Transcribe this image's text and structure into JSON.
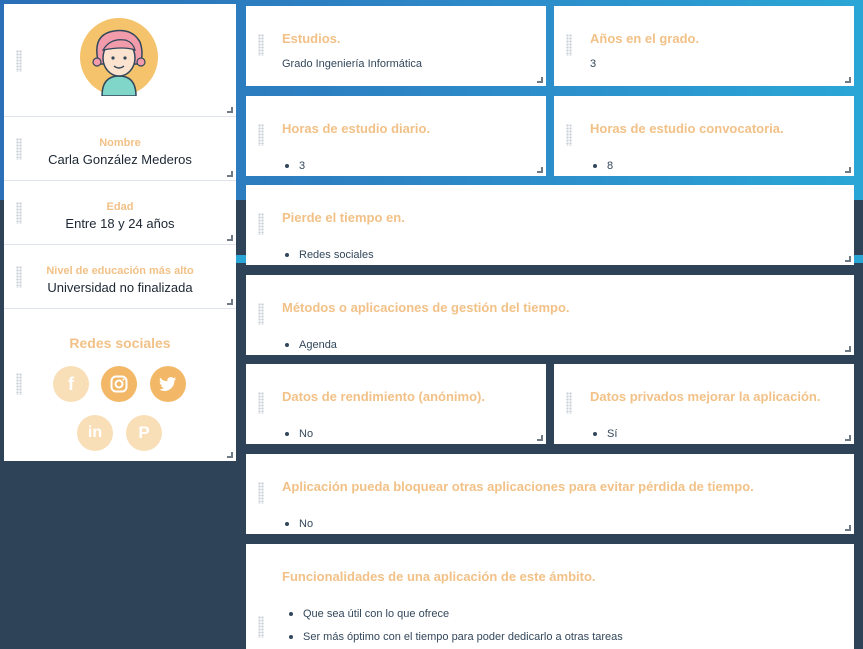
{
  "profile": {
    "name_label": "Nombre",
    "name_value": "Carla González Mederos",
    "age_label": "Edad",
    "age_value": "Entre 18 y 24 años",
    "education_label": "Nivel de educación más alto",
    "education_value": "Universidad no finalizada",
    "social_title": "Redes sociales",
    "social_icons": [
      "facebook-icon",
      "instagram-icon",
      "twitter-icon",
      "linkedin-icon",
      "pinterest-icon"
    ]
  },
  "cards": {
    "studies": {
      "title": "Estudios.",
      "value": "Grado Ingeniería Informática"
    },
    "years": {
      "title": "Años en el grado.",
      "value": "3"
    },
    "daily_hours": {
      "title": "Horas de estudio diario.",
      "items": [
        "3"
      ]
    },
    "exam_hours": {
      "title": "Horas de estudio convocatoria.",
      "items": [
        "8"
      ]
    },
    "wastes_time": {
      "title": "Pierde el tiempo en.",
      "items": [
        "Redes sociales"
      ]
    },
    "methods": {
      "title": "Métodos o aplicaciones de gestión del tiempo.",
      "items": [
        "Agenda"
      ]
    },
    "performance_data": {
      "title": "Datos de rendimiento (anónimo).",
      "items": [
        "No"
      ]
    },
    "private_data": {
      "title": "Datos privados mejorar la aplicación.",
      "items": [
        "Sí"
      ]
    },
    "block_apps": {
      "title": "Aplicación pueda bloquear otras aplicaciones para evitar pérdida de tiempo.",
      "items": [
        "No"
      ]
    },
    "features": {
      "title": "Funcionalidades de una aplicación de este ámbito.",
      "items": [
        "Que sea útil con lo que ofrece",
        "Ser más óptimo con el tiempo para poder dedicarlo a otras tareas"
      ]
    }
  },
  "colors": {
    "accent": "#f2c187",
    "social_light": "#f9dfb8",
    "social_strong": "#f2b867",
    "text": "#33475b"
  }
}
